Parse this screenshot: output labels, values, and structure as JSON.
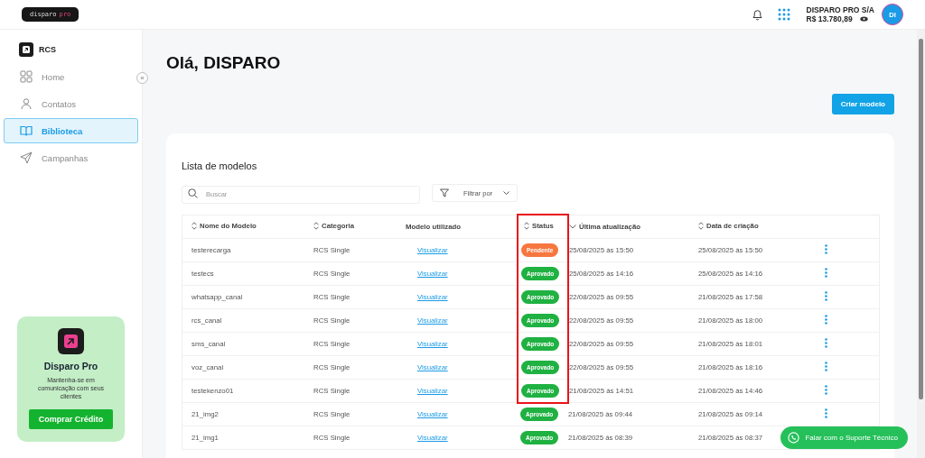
{
  "header": {
    "logo": {
      "text": "disparo",
      "accent": "pro"
    },
    "account": {
      "name": "DISPARO PRO S/A",
      "balance": "R$ 13.780,89"
    },
    "avatar": "DI"
  },
  "sidebar": {
    "product": "RCS",
    "collapse": "«",
    "items": [
      {
        "label": "Home",
        "kind": "grid",
        "selected": false
      },
      {
        "label": "Contatos",
        "kind": "user",
        "selected": false
      },
      {
        "label": "Biblioteca",
        "kind": "book",
        "selected": true
      },
      {
        "label": "Campanhas",
        "kind": "send",
        "selected": false
      }
    ],
    "promo": {
      "title": "Disparo Pro",
      "text": "Mantenha-se em comunicação com seus clientes",
      "button": "Comprar Crédito"
    }
  },
  "page": {
    "title": "Olá, DISPARO",
    "create_button": "Criar modelo"
  },
  "list": {
    "title": "Lista de modelos",
    "search": {
      "placeholder": "Buscar"
    },
    "filter": "Filtrar por",
    "columns": [
      {
        "label": "Nome do Modelo",
        "kind": "both",
        "highlighted": false
      },
      {
        "label": "Categoria",
        "kind": "both",
        "highlighted": false
      },
      {
        "label": "Modelo utilizado",
        "kind": "none",
        "highlighted": false
      },
      {
        "label": "Status",
        "kind": "both",
        "highlighted": true
      },
      {
        "label": "Última atualização",
        "kind": "down",
        "highlighted": false
      },
      {
        "label": "Data de criação",
        "kind": "both",
        "highlighted": false
      }
    ],
    "rows": [
      {
        "name": "testerecarga",
        "category": "RCS Single",
        "link": "Visualizar",
        "status": "Pendente",
        "kind": "pending",
        "updated": "25/08/2025 às 15:50",
        "created": "25/08/2025 às 15:50",
        "highlighted": true
      },
      {
        "name": "testecs",
        "category": "RCS Single",
        "link": "Visualizar",
        "status": "Aprovado",
        "kind": "approved",
        "updated": "25/08/2025 às 14:16",
        "created": "25/08/2025 às 14:16",
        "highlighted": true
      },
      {
        "name": "whatsapp_canal",
        "category": "RCS Single",
        "link": "Visualizar",
        "status": "Aprovado",
        "kind": "approved",
        "updated": "22/08/2025 às 09:55",
        "created": "21/08/2025 às 17:58",
        "highlighted": true
      },
      {
        "name": "rcs_canal",
        "category": "RCS Single",
        "link": "Visualizar",
        "status": "Aprovado",
        "kind": "approved",
        "updated": "22/08/2025 às 09:55",
        "created": "21/08/2025 às 18:00",
        "highlighted": true
      },
      {
        "name": "sms_canal",
        "category": "RCS Single",
        "link": "Visualizar",
        "status": "Aprovado",
        "kind": "approved",
        "updated": "22/08/2025 às 09:55",
        "created": "21/08/2025 às 18:01",
        "highlighted": true
      },
      {
        "name": "voz_canal",
        "category": "RCS Single",
        "link": "Visualizar",
        "status": "Aprovado",
        "kind": "approved",
        "updated": "22/08/2025 às 09:55",
        "created": "21/08/2025 às 18:16",
        "highlighted": true
      },
      {
        "name": "testekenzo01",
        "category": "RCS Single",
        "link": "Visualizar",
        "status": "Aprovado",
        "kind": "approved",
        "updated": "21/08/2025 às 14:51",
        "created": "21/08/2025 às 14:46",
        "highlighted": true
      },
      {
        "name": "21_img2",
        "category": "RCS Single",
        "link": "Visualizar",
        "status": "Aprovado",
        "kind": "approved",
        "updated": "21/08/2025 às 09:44",
        "created": "21/08/2025 às 09:14"
      },
      {
        "name": "21_img1",
        "category": "RCS Single",
        "link": "Visualizar",
        "status": "Aprovado",
        "kind": "approved",
        "updated": "21/08/2025 às 08:39",
        "created": "21/08/2025 às 08:37"
      }
    ]
  },
  "support_button": "Falar com o Suporte Técnico"
}
